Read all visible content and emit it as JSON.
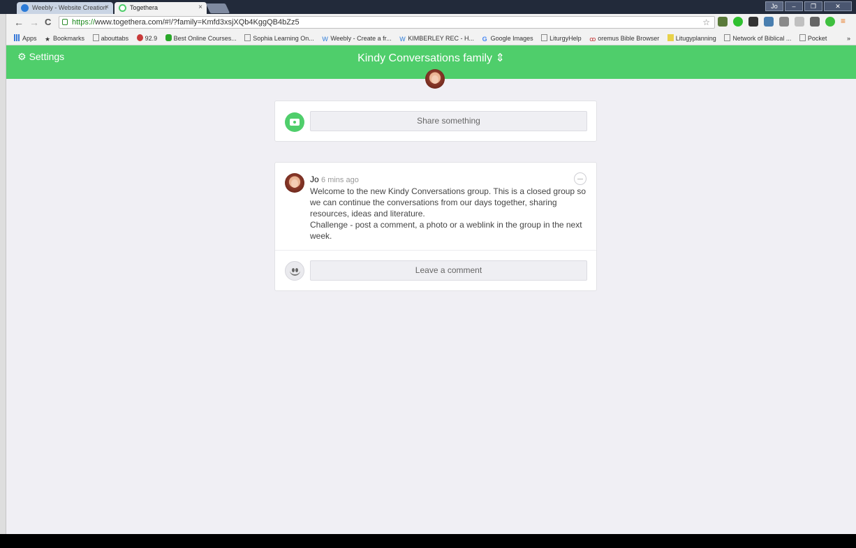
{
  "browser": {
    "tabs": [
      {
        "title": "Weebly - Website Creation",
        "active": false,
        "favicon_color": "#2b7bd8"
      },
      {
        "title": "Togethera",
        "active": true,
        "favicon_color": "#4fce6b"
      }
    ],
    "tab_close": "×",
    "nav": {
      "back": "←",
      "forward": "→",
      "reload": "C"
    },
    "url_scheme": "https://",
    "url_rest": "www.togethera.com/#!/?family=Kmfd3xsjXQb4KggQB4bZz5",
    "star": "☆",
    "bookmarks": [
      "Apps",
      "Bookmarks",
      "abouttabs",
      "92.9",
      "Best Online Courses...",
      "Sophia Learning On...",
      "Weebly - Create a fr...",
      "KIMBERLEY REC - H...",
      "Google Images",
      "LiturgyHelp",
      "oremus Bible Browser",
      "Litugyplanning",
      "Network of Biblical ...",
      "Pocket"
    ],
    "bookmarks_more": "»",
    "window_user": "Jo"
  },
  "app": {
    "settings_label": "Settings",
    "settings_icon": "gear-icon",
    "family_title": "Kindy Conversations family ⇕",
    "accent_color": "#4fce6b",
    "share_placeholder": "Share something",
    "post": {
      "author": "Jo",
      "time": "6 mins ago",
      "text_1": "Welcome to the new Kindy Conversations group. This is a closed group so we can continue the conversations from our days together, sharing resources, ideas and literature.",
      "text_2": "Challenge - post a comment, a photo or a weblink in the group in the next week."
    },
    "comment_placeholder": "Leave a comment"
  }
}
